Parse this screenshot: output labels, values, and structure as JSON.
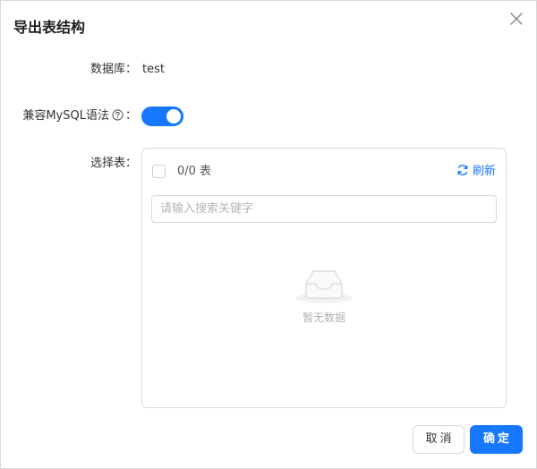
{
  "dialog": {
    "title": "导出表结构"
  },
  "form": {
    "database_label": "数据库：",
    "database_value": "test",
    "mysql_compat_label": "兼容MySQL语法",
    "mysql_compat_suffix": "：",
    "mysql_compat_enabled": true,
    "table_select_label": "选择表："
  },
  "table_panel": {
    "count_text": "0/0 表",
    "refresh_label": "刷新",
    "search_placeholder": "请输入搜索关键字",
    "empty_text": "暂无数据"
  },
  "footer": {
    "cancel_label": "取消",
    "ok_label": "确定"
  },
  "colors": {
    "primary": "#1677ff",
    "border": "#d9d9d9"
  },
  "icons": {
    "close": "close-icon",
    "help": "question-circle-icon",
    "refresh": "sync-icon",
    "empty": "inbox-empty-icon"
  }
}
